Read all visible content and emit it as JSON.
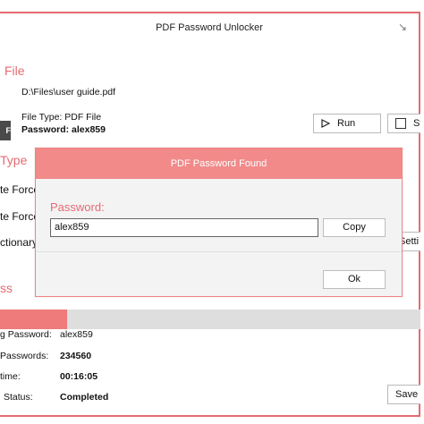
{
  "window": {
    "title": "PDF Password Unlocker"
  },
  "file": {
    "section_title": "File",
    "path": "D:\\Files\\user guide.pdf",
    "type_label": "File Type: PDF File",
    "password_label": "Password: alex859"
  },
  "type_section": {
    "section_title": "Type",
    "option1": "te Force",
    "option2": "te Force",
    "option3": "ctionary A"
  },
  "buttons": {
    "run": "Run",
    "stop": "Sto",
    "settings": "Setti",
    "save": "Save I"
  },
  "progress": {
    "section_title": "ss",
    "percent": 12,
    "labels": [
      "g Password:",
      "Passwords:",
      "time:",
      "Status:"
    ],
    "values": [
      "alex859",
      "234560",
      "00:16:05",
      "Completed"
    ]
  },
  "dialog": {
    "title": "PDF Password Found",
    "password_label": "Password:",
    "password_value": "alex859",
    "copy_label": "Copy",
    "ok_label": "Ok"
  },
  "pdf_badge": "F",
  "icons": {
    "minimize": "minimize-arrow-icon",
    "run": "play-icon"
  }
}
